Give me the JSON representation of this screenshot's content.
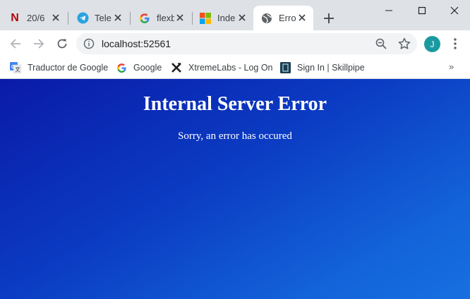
{
  "tabs": [
    {
      "title": "20/6",
      "icon": "netflix-n-icon"
    },
    {
      "title": "Tele",
      "icon": "telegram-icon"
    },
    {
      "title": "flexb",
      "icon": "google-g-icon"
    },
    {
      "title": "Inde",
      "icon": "microsoft-logo-icon"
    },
    {
      "title": "Erro",
      "icon": "globe-icon",
      "active": true
    }
  ],
  "favicon_netflix_text": "N",
  "omnibox": {
    "url": "localhost:52561"
  },
  "profile": {
    "initial": "J",
    "color": "#1a9aa0"
  },
  "bookmarks": [
    {
      "label": "Traductor de Google",
      "icon": "google-translate-icon"
    },
    {
      "label": "Google",
      "icon": "google-g-icon"
    },
    {
      "label": "XtremeLabs - Log On",
      "icon": "xtremelabs-icon"
    },
    {
      "label": "Sign In | Skillpipe",
      "icon": "skillpipe-icon"
    }
  ],
  "bookmarks_overflow": "»",
  "page": {
    "heading": "Internal Server Error",
    "message": "Sorry, an error has occured"
  },
  "colors": {
    "tabstrip": "#dee1e6",
    "page_gradient_start": "#0a1aa8",
    "page_gradient_end": "#1670e0"
  }
}
